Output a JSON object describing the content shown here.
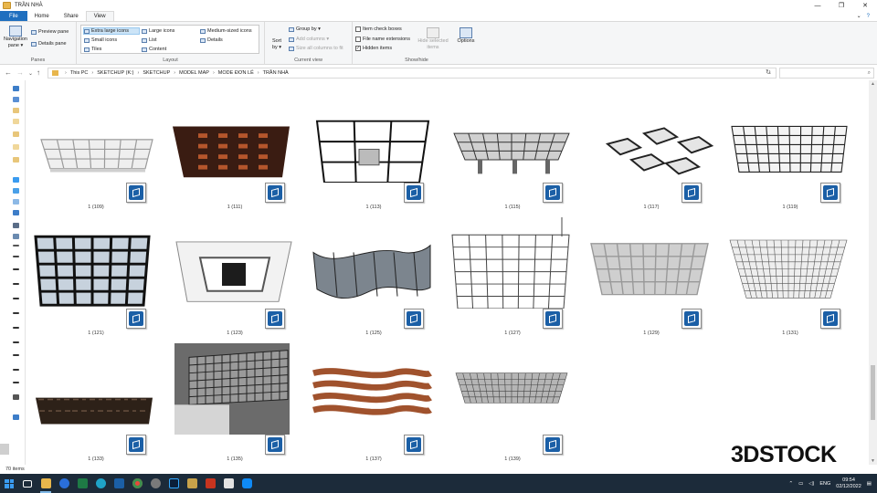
{
  "window": {
    "title": "TRẦN NHÀ",
    "controls": [
      "—",
      "❐",
      "✕"
    ]
  },
  "tabs": {
    "file": "File",
    "home": "Home",
    "share": "Share",
    "view": "View"
  },
  "ribbon": {
    "panes": {
      "label": "Panes",
      "navigation_pane": "Navigation pane ▾",
      "preview_pane": "Preview pane",
      "details_pane": "Details pane"
    },
    "layout": {
      "label": "Layout",
      "options": [
        "Extra large icons",
        "Large icons",
        "Medium-sized icons",
        "Small icons",
        "List",
        "Details",
        "Tiles",
        "Content"
      ],
      "selected": "Extra large icons"
    },
    "current_view": {
      "label": "Current view",
      "sort_by": "Sort by ▾",
      "group_by": "Group by ▾",
      "add_columns": "Add columns ▾",
      "size_all_columns": "Size all columns to fit"
    },
    "show_hide": {
      "label": "Show/hide",
      "item_check_boxes": "Item check boxes",
      "file_name_extensions": "File name extensions",
      "hidden_items": "Hidden items",
      "hide_selected": "Hide selected items",
      "options": "Options"
    }
  },
  "address": {
    "crumbs": [
      "This PC",
      "SKETCHUP (K:)",
      "SKETCHUP",
      "MODEL MAP",
      "MODE ĐƠN LẺ",
      "TRẦN NHÀ"
    ],
    "search_placeholder": ""
  },
  "files": [
    {
      "name": "1 (109)",
      "style": "white-grid"
    },
    {
      "name": "1 (111)",
      "style": "dark-panel"
    },
    {
      "name": "1 (113)",
      "style": "big-grid"
    },
    {
      "name": "1 (115)",
      "style": "grid-pillars"
    },
    {
      "name": "1 (117)",
      "style": "hex-clusters"
    },
    {
      "name": "1 (119)",
      "style": "wire-grid"
    },
    {
      "name": "1 (121)",
      "style": "dark-frame-grid"
    },
    {
      "name": "1 (123)",
      "style": "tray-ceiling"
    },
    {
      "name": "1 (125)",
      "style": "wave"
    },
    {
      "name": "1 (127)",
      "style": "frame-perspective"
    },
    {
      "name": "1 (129)",
      "style": "cushion-grid"
    },
    {
      "name": "1 (131)",
      "style": "fine-grid"
    },
    {
      "name": "1 (133)",
      "style": "dark-slab"
    },
    {
      "name": "1 (135)",
      "style": "building"
    },
    {
      "name": "1 (137)",
      "style": "wood-waves"
    },
    {
      "name": "1 (139)",
      "style": "mesh-slab"
    }
  ],
  "status": {
    "item_count": "70 items"
  },
  "watermark": "3DSTOCK",
  "taskbar": {
    "lang": "ENG",
    "time": "09:54",
    "date": "02/12/2022"
  },
  "colors": {
    "file_tab": "#1f6fbf",
    "sketchup_badge": "#1b5fa6",
    "taskbar": "#1c2b3a"
  }
}
